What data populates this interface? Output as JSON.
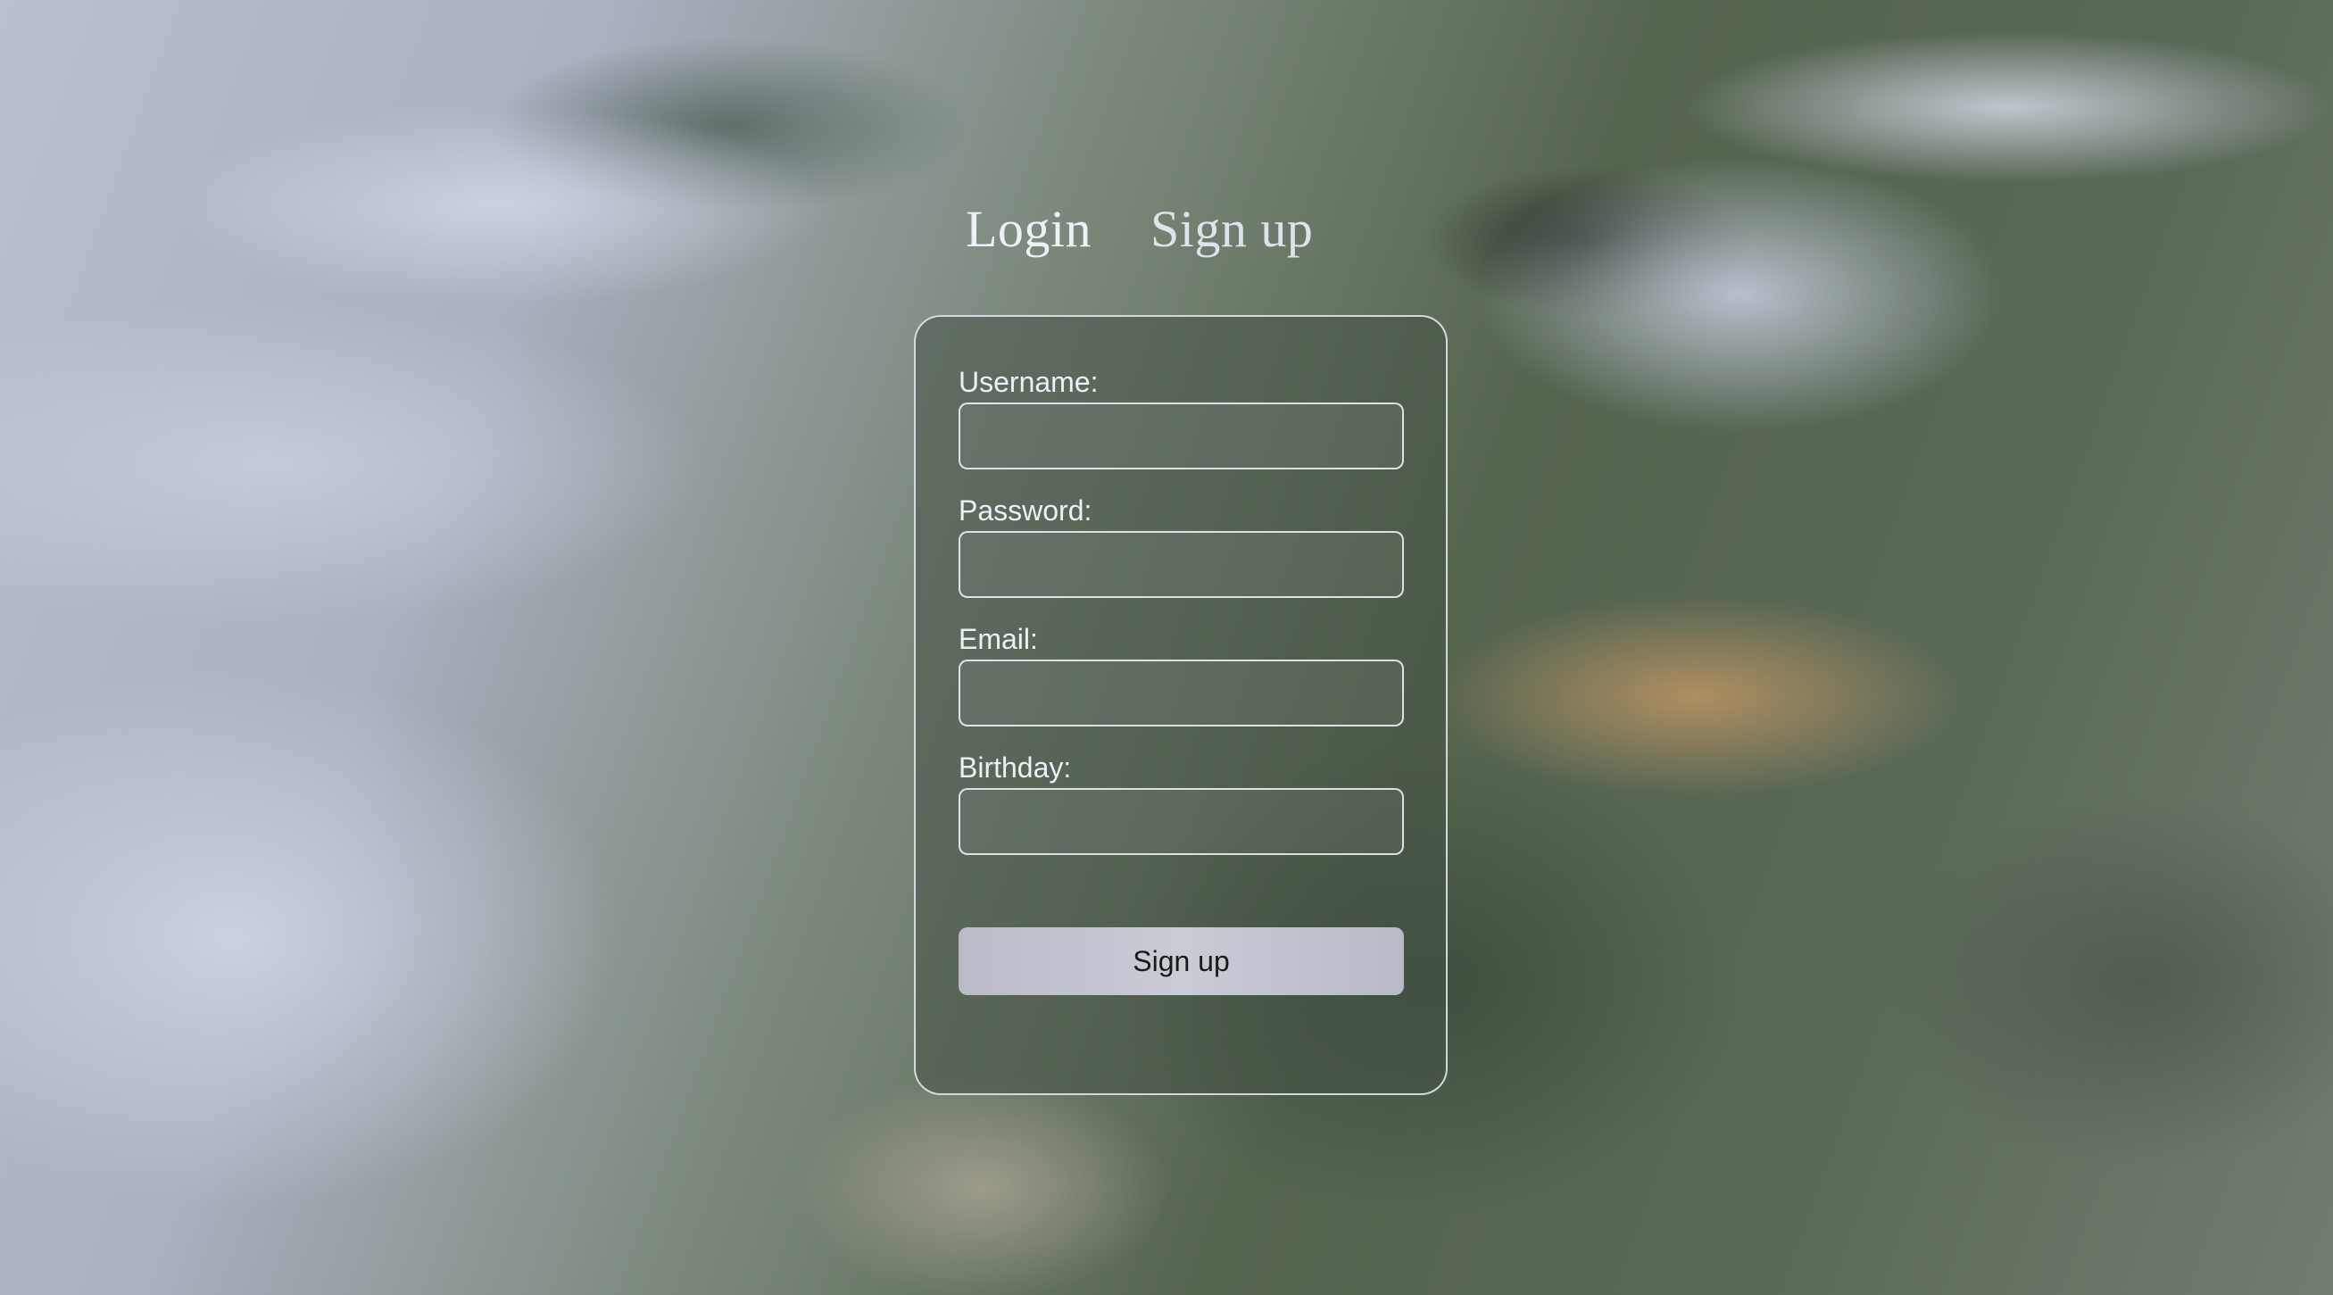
{
  "tabs": {
    "login": "Login",
    "signup": "Sign up"
  },
  "form": {
    "fields": [
      {
        "label": "Username:",
        "value": ""
      },
      {
        "label": "Password:",
        "value": ""
      },
      {
        "label": "Email:",
        "value": ""
      },
      {
        "label": "Birthday:",
        "value": ""
      }
    ],
    "submit_label": "Sign up"
  }
}
